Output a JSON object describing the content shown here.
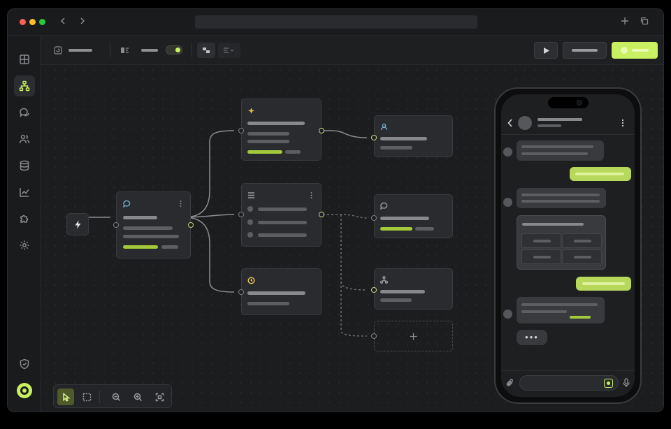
{
  "window": {
    "traffic_lights": [
      "#ff5f57",
      "#febc2e",
      "#28c840"
    ],
    "nav_back_icon": "chevron-left",
    "nav_forward_icon": "chevron-right",
    "new_tab_icon": "plus",
    "tabs_icon": "copy",
    "address": ""
  },
  "sidebar": {
    "items": [
      {
        "icon": "grid-icon",
        "active": false
      },
      {
        "icon": "flow-icon",
        "active": true
      },
      {
        "icon": "chat-icon",
        "active": false
      },
      {
        "icon": "users-icon",
        "active": false
      },
      {
        "icon": "database-icon",
        "active": false
      },
      {
        "icon": "chart-icon",
        "active": false
      },
      {
        "icon": "puzzle-icon",
        "active": false
      },
      {
        "icon": "settings-icon",
        "active": false
      }
    ],
    "bottom": [
      {
        "icon": "shield-icon"
      },
      {
        "icon": "profile-icon"
      }
    ]
  },
  "toolbar": {
    "toggle_on": true,
    "run_icon": "play",
    "accent": "#c8f060"
  },
  "flow": {
    "trigger_icon": "bolt",
    "nodes": [
      {
        "id": "message",
        "icon": "message-icon"
      },
      {
        "id": "ai",
        "icon": "sparkle-icon"
      },
      {
        "id": "options",
        "icon": "list-icon"
      },
      {
        "id": "delay",
        "icon": "clock-icon"
      },
      {
        "id": "contact",
        "icon": "user-icon"
      },
      {
        "id": "reply",
        "icon": "message-icon"
      },
      {
        "id": "route",
        "icon": "branch-icon"
      },
      {
        "id": "add",
        "icon": "plus-icon"
      }
    ]
  },
  "preview": {
    "typing_dots": "•••",
    "accent": "#b7d85a"
  }
}
